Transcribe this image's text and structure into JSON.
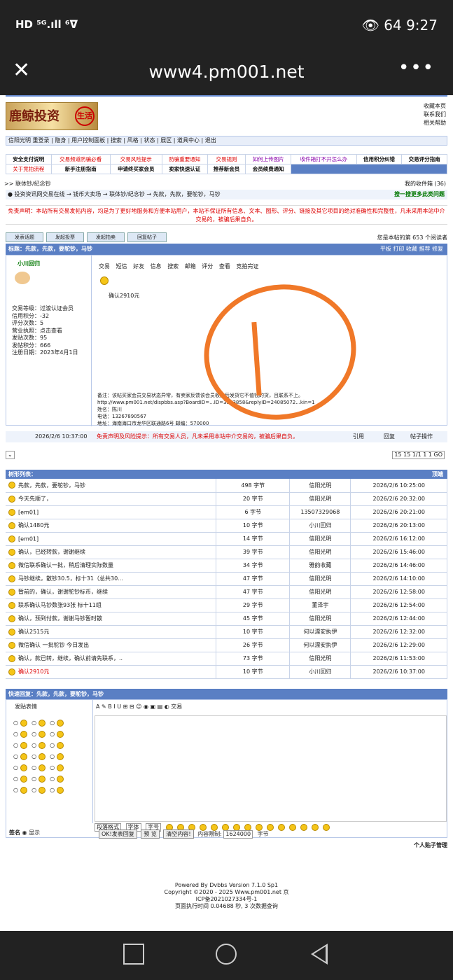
{
  "status": {
    "left": "HD ⁵ᴳ.ıll ⁶ᐁ",
    "right": "👁 64 9:27"
  },
  "browser": {
    "url": "www4.pm001.net",
    "close": "✕",
    "menu": "•••"
  },
  "site": {
    "logo": "鹿鲸投资",
    "seal": "生活",
    "toplinks": [
      "收藏本页",
      "联系我们",
      "相关帮助"
    ]
  },
  "menu": "信阳光明 重登录 | 隐身 | 用户控制面板 | 搜索 | 风格 | 状态 | 展区 | 道具中心 | 退出",
  "grid": [
    [
      "安全支付说明",
      "交易频道防骗必看",
      "交易风险提示",
      "防骗重要通知",
      "交易规则",
      "如何上传图片",
      "收件箱打不开怎么办",
      "信用积分纠错",
      "交易评分指南"
    ],
    [
      "关于竞拍流程",
      "新手注册指南",
      "申请终买家会员",
      "卖家快速认证",
      "推荐新会员",
      "会员续费通知",
      "",
      "",
      ""
    ]
  ],
  "breadcrumb": ">> 联体钞/纪念钞",
  "mailbox": "我的收件箱 (36)",
  "info": "● 投资资讯网交易在线 → 钱币大卖场 → 联体钞/纪念钞 → 先款，先款，要鸵钞，马钞",
  "search_more": "搜一搜更多此类问题",
  "notice": "免责声明：本站所有交易发帖内容，均是为了更好地服务和方便本站用户，本站不保证所有信息、文本、图形、评分、链接及其它项目的绝对准确性和完整性，凡未采用本站中介交易的，被骗后果自负。",
  "buttons": [
    "发表话题",
    "发起投票",
    "发起拍卖",
    "回复帖子"
  ],
  "readers": "您是本帖的第 653 个阅读者",
  "topic": {
    "title": "标题：先款，先款，要鸵钞，马钞",
    "actions": "平板 打印 收藏 推荐 修复"
  },
  "user": {
    "name": "小川回归",
    "stats": [
      "交易等级：过渡认证会员",
      "信用积分：-32",
      "评分次数：5",
      "营业执照：点击查看",
      "发贴次数：95",
      "发帖积分：666",
      "注册日期：2023年4月1日"
    ]
  },
  "post": {
    "tools": [
      "交易",
      "短信",
      "好友",
      "信息",
      "搜索",
      "邮箱",
      "评分",
      "查看",
      "竞拍完证"
    ],
    "text": "确认2910元",
    "sig": [
      "备注：该帖买家会员交易状态异常，有卖家反馈该会员收款后发货它不值钱的货，且联系不上。",
      "http://www.pm001.net/dispbbs.asp?BoardID=...ID=3573858&replyID=24085072...kin=1",
      "姓名：陈川",
      "电话：13267890567",
      "地址：海南海口市龙华区联通路6号 邮编：570000"
    ]
  },
  "footerrow": {
    "time": "2026/2/6 10:37:00",
    "warn": "免责声明及风险提示：所有交易人员，凡未采用本站中介交易的，被骗后果自负。",
    "links": [
      "引用",
      "回复",
      "帖子操作"
    ]
  },
  "pager": "15 15 1/1 1 1  GO",
  "tree_title": "树形列表：",
  "tree_right": "顶端",
  "tree": [
    [
      "先款，先款，要鸵钞，马钞",
      "498 字节",
      "信阳光明",
      "2026/2/6 10:25:00"
    ],
    [
      "今天先顺了，",
      "20 字节",
      "信阳光明",
      "2026/2/6 20:32:00"
    ],
    [
      "[em01]",
      "6 字节",
      "13507329068",
      "2026/2/6 20:21:00"
    ],
    [
      "确认1480元",
      "10 字节",
      "小川回归",
      "2026/2/6 20:13:00"
    ],
    [
      "[em01]",
      "14 字节",
      "信阳光明",
      "2026/2/6 16:12:00"
    ],
    [
      "确认，已经转款，谢谢继续",
      "39 字节",
      "信阳光明",
      "2026/2/6 15:46:00"
    ],
    [
      "微信联系确认一批，稍后清理实际数量",
      "34 字节",
      "雅韵收藏",
      "2026/2/6 14:46:00"
    ],
    [
      "马钞继续，散钞30.5，标十31（总共30...",
      "47 字节",
      "信阳光明",
      "2026/2/6 14:10:00"
    ],
    [
      "暂前的，确认，谢谢鸵钞标币，继续",
      "47 字节",
      "信阳光明",
      "2026/2/6 12:58:00"
    ],
    [
      "联系确认马钞数张93张 标十11组",
      "29 字节",
      "董泽宇",
      "2026/2/6 12:54:00"
    ],
    [
      "确认，预到付款，谢谢马钞暂时散",
      "45 字节",
      "信阳光明",
      "2026/2/6 12:44:00"
    ],
    [
      "确认2515元",
      "10 字节",
      "何以漂安执伊",
      "2026/2/6 12:32:00"
    ],
    [
      "微信确认 一批鸵钞 今日发出",
      "26 字节",
      "何以漂安执伊",
      "2026/2/6 12:29:00"
    ],
    [
      "确认，款已转，继续，确认前请先联系，..",
      "73 字节",
      "信阳光明",
      "2026/2/6 11:53:00"
    ],
    [
      "确认2910元",
      "10 字节",
      "小川回归",
      "2026/2/6 10:37:00"
    ]
  ],
  "quick": {
    "title": "快速回复：先款，先款，要鸵钞，马钞",
    "emo_label": "发贴表情",
    "selects": [
      "段落格式",
      "字体",
      "字号"
    ],
    "sig_label": "签名",
    "show": "显示",
    "buttons": [
      "OK!发表回复",
      "预 览",
      "清空内容!"
    ],
    "limit_label": "内容限制:",
    "limit": "1624000",
    "unit": "字节",
    "manage": "个人贴子管理"
  },
  "footer": [
    "Powered By Dvbbs Version 7.1.0 Sp1",
    "Copyright ©2020 - 2025 Www.pm001.net 京",
    "ICP备2021027334号-1",
    "页面执行时间 0.04688 秒, 3 次数据查询"
  ]
}
